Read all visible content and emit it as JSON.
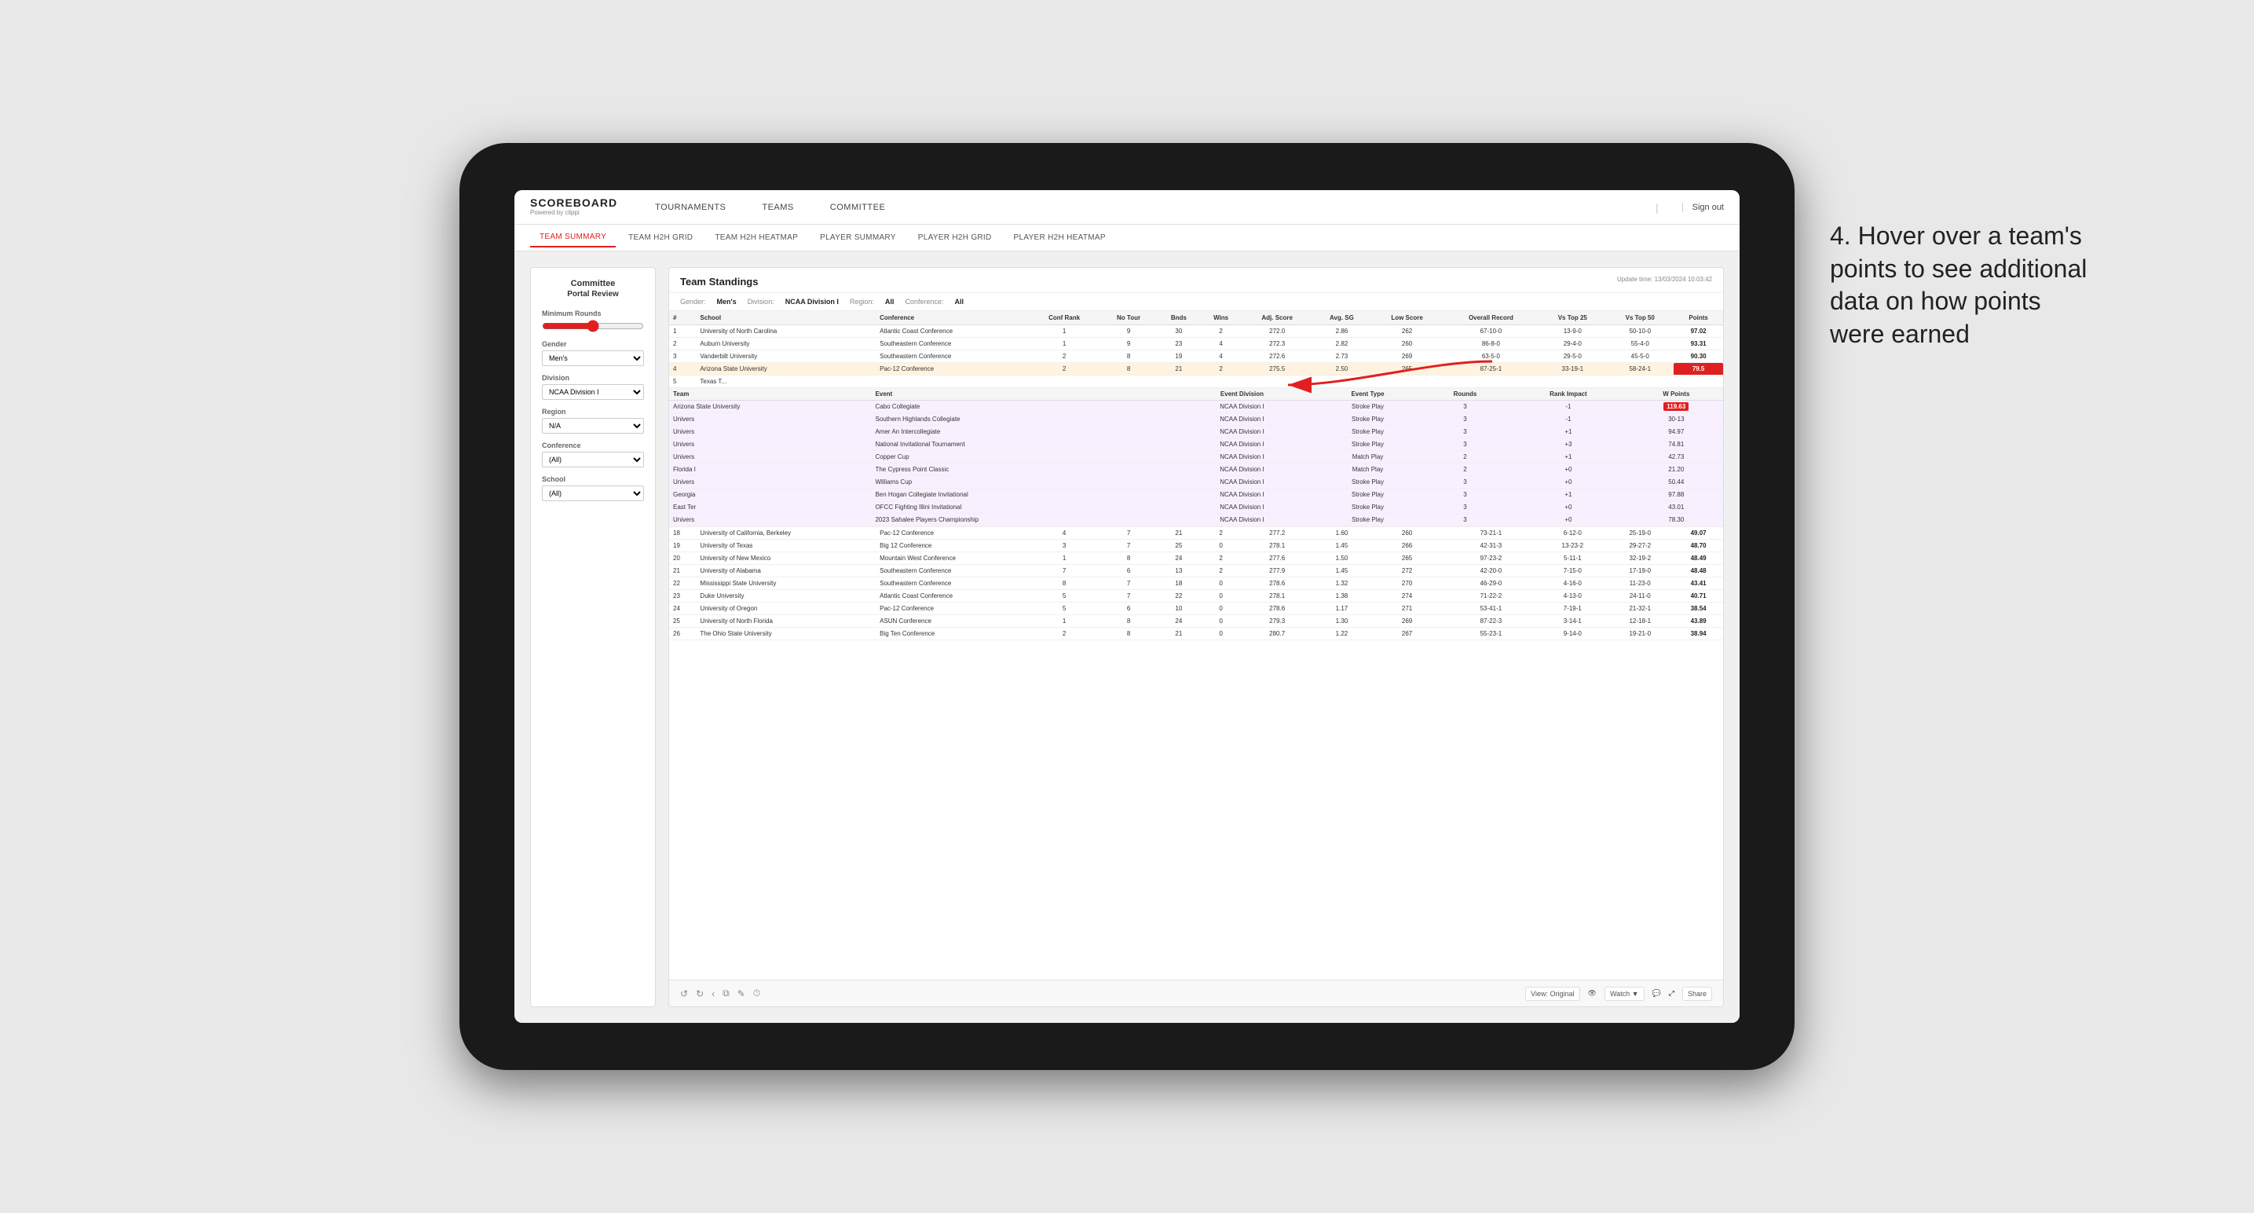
{
  "nav": {
    "logo": "SCOREBOARD",
    "logo_sub": "Powered by clippi",
    "items": [
      "TOURNAMENTS",
      "TEAMS",
      "COMMITTEE"
    ],
    "sign_out": "Sign out"
  },
  "sub_nav": {
    "items": [
      "TEAM SUMMARY",
      "TEAM H2H GRID",
      "TEAM H2H HEATMAP",
      "PLAYER SUMMARY",
      "PLAYER H2H GRID",
      "PLAYER H2H HEATMAP"
    ],
    "active": "TEAM SUMMARY"
  },
  "sidebar": {
    "title": "Committee",
    "subtitle": "Portal Review",
    "min_rounds_label": "Minimum Rounds",
    "gender_label": "Gender",
    "gender_value": "Men's",
    "division_label": "Division",
    "division_value": "NCAA Division I",
    "region_label": "Region",
    "region_value": "N/A",
    "conference_label": "Conference",
    "conference_value": "(All)",
    "school_label": "School",
    "school_value": "(All)"
  },
  "panel": {
    "title": "Team Standings",
    "update_time": "Update time: 13/03/2024 10:03:42",
    "filters": {
      "gender_label": "Gender:",
      "gender_val": "Men's",
      "division_label": "Division:",
      "division_val": "NCAA Division I",
      "region_label": "Region:",
      "region_val": "All",
      "conference_label": "Conference:",
      "conference_val": "All"
    },
    "columns": [
      "#",
      "School",
      "Conference",
      "Conf Rank",
      "No Tour",
      "Bnds",
      "Wins",
      "Adj. Score",
      "Avg. SG",
      "Low Score",
      "Overall Record",
      "Vs Top 25",
      "Vs Top 50",
      "Points"
    ],
    "rows": [
      {
        "rank": 1,
        "school": "University of North Carolina",
        "conf": "Atlantic Coast Conference",
        "conf_rank": 1,
        "no_tour": 9,
        "bnds": 30,
        "wins": 2,
        "adj_score": "272.0",
        "avg_sg": "2.86",
        "low_score": "262",
        "overall_record": "67-10-0",
        "vs_top25": "13-9-0",
        "vs_top50": "50-10-0",
        "points": "97.02",
        "highlight": false
      },
      {
        "rank": 2,
        "school": "Auburn University",
        "conf": "Southeastern Conference",
        "conf_rank": 1,
        "no_tour": 9,
        "bnds": 23,
        "wins": 4,
        "adj_score": "272.3",
        "avg_sg": "2.82",
        "low_score": "260",
        "overall_record": "86-8-0",
        "vs_top25": "29-4-0",
        "vs_top50": "55-4-0",
        "points": "93.31",
        "highlight": false
      },
      {
        "rank": 3,
        "school": "Vanderbilt University",
        "conf": "Southeastern Conference",
        "conf_rank": 2,
        "no_tour": 8,
        "bnds": 19,
        "wins": 4,
        "adj_score": "272.6",
        "avg_sg": "2.73",
        "low_score": "269",
        "overall_record": "63-5-0",
        "vs_top25": "29-5-0",
        "vs_top50": "45-5-0",
        "points": "90.30",
        "highlight": false
      },
      {
        "rank": 4,
        "school": "Arizona State University",
        "conf": "Pac-12 Conference",
        "conf_rank": 2,
        "no_tour": 8,
        "bnds": 21,
        "wins": 2,
        "adj_score": "275.5",
        "avg_sg": "2.50",
        "low_score": "265",
        "overall_record": "87-25-1",
        "vs_top25": "33-19-1",
        "vs_top50": "58-24-1",
        "points": "79.5",
        "highlight": true
      },
      {
        "rank": 5,
        "school": "Texas T...",
        "conf": "",
        "conf_rank": "",
        "no_tour": "",
        "bnds": "",
        "wins": "",
        "adj_score": "",
        "avg_sg": "",
        "low_score": "",
        "overall_record": "",
        "vs_top25": "",
        "vs_top50": "",
        "points": "",
        "highlight": false
      },
      {
        "rank": 18,
        "school": "University of California, Berkeley",
        "conf": "Pac-12 Conference",
        "conf_rank": 4,
        "no_tour": 7,
        "bnds": 21,
        "wins": 2,
        "adj_score": "277.2",
        "avg_sg": "1.60",
        "low_score": "260",
        "overall_record": "73-21-1",
        "vs_top25": "6-12-0",
        "vs_top50": "25-19-0",
        "points": "49.07",
        "highlight": false
      },
      {
        "rank": 19,
        "school": "University of Texas",
        "conf": "Big 12 Conference",
        "conf_rank": 3,
        "no_tour": 7,
        "bnds": 25,
        "wins": 0,
        "adj_score": "278.1",
        "avg_sg": "1.45",
        "low_score": "266",
        "overall_record": "42-31-3",
        "vs_top25": "13-23-2",
        "vs_top50": "29-27-2",
        "points": "48.70",
        "highlight": false
      },
      {
        "rank": 20,
        "school": "University of New Mexico",
        "conf": "Mountain West Conference",
        "conf_rank": 1,
        "no_tour": 8,
        "bnds": 24,
        "wins": 2,
        "adj_score": "277.6",
        "avg_sg": "1.50",
        "low_score": "265",
        "overall_record": "97-23-2",
        "vs_top25": "5-11-1",
        "vs_top50": "32-19-2",
        "points": "48.49",
        "highlight": false
      },
      {
        "rank": 21,
        "school": "University of Alabama",
        "conf": "Southeastern Conference",
        "conf_rank": 7,
        "no_tour": 6,
        "bnds": 13,
        "wins": 2,
        "adj_score": "277.9",
        "avg_sg": "1.45",
        "low_score": "272",
        "overall_record": "42-20-0",
        "vs_top25": "7-15-0",
        "vs_top50": "17-19-0",
        "points": "48.48",
        "highlight": false
      },
      {
        "rank": 22,
        "school": "Mississippi State University",
        "conf": "Southeastern Conference",
        "conf_rank": 8,
        "no_tour": 7,
        "bnds": 18,
        "wins": 0,
        "adj_score": "278.6",
        "avg_sg": "1.32",
        "low_score": "270",
        "overall_record": "46-29-0",
        "vs_top25": "4-16-0",
        "vs_top50": "11-23-0",
        "points": "43.41",
        "highlight": false
      },
      {
        "rank": 23,
        "school": "Duke University",
        "conf": "Atlantic Coast Conference",
        "conf_rank": 5,
        "no_tour": 7,
        "bnds": 22,
        "wins": 0,
        "adj_score": "278.1",
        "avg_sg": "1.38",
        "low_score": "274",
        "overall_record": "71-22-2",
        "vs_top25": "4-13-0",
        "vs_top50": "24-11-0",
        "points": "40.71",
        "highlight": false
      },
      {
        "rank": 24,
        "school": "University of Oregon",
        "conf": "Pac-12 Conference",
        "conf_rank": 5,
        "no_tour": 6,
        "bnds": 10,
        "wins": 0,
        "adj_score": "278.6",
        "avg_sg": "1.17",
        "low_score": "271",
        "overall_record": "53-41-1",
        "vs_top25": "7-19-1",
        "vs_top50": "21-32-1",
        "points": "38.54",
        "highlight": false
      },
      {
        "rank": 25,
        "school": "University of North Florida",
        "conf": "ASUN Conference",
        "conf_rank": 1,
        "no_tour": 8,
        "bnds": 24,
        "wins": 0,
        "adj_score": "279.3",
        "avg_sg": "1.30",
        "low_score": "269",
        "overall_record": "87-22-3",
        "vs_top25": "3-14-1",
        "vs_top50": "12-18-1",
        "points": "43.89",
        "highlight": false
      },
      {
        "rank": 26,
        "school": "The Ohio State University",
        "conf": "Big Ten Conference",
        "conf_rank": 2,
        "no_tour": 8,
        "bnds": 21,
        "wins": 0,
        "adj_score": "280.7",
        "avg_sg": "1.22",
        "low_score": "267",
        "overall_record": "55-23-1",
        "vs_top25": "9-14-0",
        "vs_top50": "19-21-0",
        "points": "38.94",
        "highlight": false
      }
    ],
    "tooltip_rows": [
      {
        "team": "University",
        "event": "Cabo Collegiate",
        "division": "NCAA Division I",
        "type": "Stroke Play",
        "rounds": 3,
        "rank_impact": "-1",
        "points": "119.63"
      },
      {
        "team": "University",
        "event": "Southern Highlands Collegiate",
        "division": "NCAA Division I",
        "type": "Stroke Play",
        "rounds": 3,
        "rank_impact": "-1",
        "points": "30-13"
      },
      {
        "team": "Univers",
        "event": "Amer An Intercollegiate",
        "division": "NCAA Division I",
        "type": "Stroke Play",
        "rounds": 3,
        "rank_impact": "+1",
        "points": "94.97"
      },
      {
        "team": "Univers",
        "event": "National Invitational Tournament",
        "division": "NCAA Division I",
        "type": "Stroke Play",
        "rounds": 3,
        "rank_impact": "+3",
        "points": "74.81"
      },
      {
        "team": "Univers",
        "event": "Copper Cup",
        "division": "NCAA Division I",
        "type": "Match Play",
        "rounds": 2,
        "rank_impact": "+1",
        "points": "42.73"
      },
      {
        "team": "Florida I",
        "event": "The Cypress Point Classic",
        "division": "NCAA Division I",
        "type": "Match Play",
        "rounds": 2,
        "rank_impact": "+0",
        "points": "21.20"
      },
      {
        "team": "Univers",
        "event": "Williams Cup",
        "division": "NCAA Division I",
        "type": "Stroke Play",
        "rounds": 3,
        "rank_impact": "+0",
        "points": "50.44"
      },
      {
        "team": "Georgia",
        "event": "Ben Hogan Collegiate Invitational",
        "division": "NCAA Division I",
        "type": "Stroke Play",
        "rounds": 3,
        "rank_impact": "+1",
        "points": "97.88"
      },
      {
        "team": "East Ter",
        "event": "OFCC Fighting Illini Invitational",
        "division": "NCAA Division I",
        "type": "Stroke Play",
        "rounds": 3,
        "rank_impact": "+0",
        "points": "43.01"
      },
      {
        "team": "Univers",
        "event": "2023 Sahalee Players Championship",
        "division": "NCAA Division I",
        "type": "Stroke Play",
        "rounds": 3,
        "rank_impact": "+0",
        "points": "78.30"
      }
    ],
    "tooltip_columns": [
      "Team",
      "Event",
      "Event Division",
      "Event Type",
      "Rounds",
      "Rank Impact",
      "W Points"
    ]
  },
  "toolbar": {
    "view_label": "View: Original",
    "watch_label": "Watch ▼",
    "share_label": "Share"
  },
  "annotation": {
    "text": "4. Hover over a team's points to see additional data on how points were earned"
  }
}
